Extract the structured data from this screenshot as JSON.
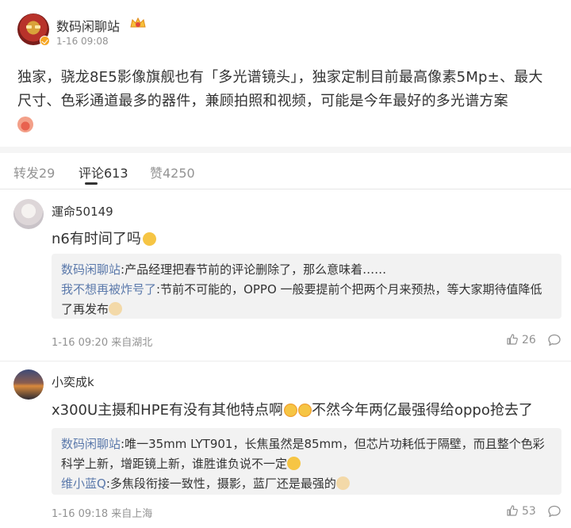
{
  "post": {
    "author": "数码闲聊站",
    "time": "1-16 09:08",
    "body": "独家，骁龙8E5影像旗舰也有「多光谱镜头」，独家定制目前最高像素5Mp±、最大尺寸、色彩通道最多的器件，兼顾拍照和视频，可能是今年最好的多光谱方案"
  },
  "tabs": [
    {
      "label": "转发29"
    },
    {
      "label": "评论613"
    },
    {
      "label": "赞4250"
    }
  ],
  "comments": [
    {
      "name": "運命50149",
      "text": "n6有时间了吗",
      "replies": [
        {
          "user": "数码闲聊站",
          "text": ":产品经理把春节前的评论删除了，那么意味着……"
        },
        {
          "user": "我不想再被炸号了",
          "text": ":节前不可能的，OPPO 一般要提前个把两个月来预热，等大家期待值降低了再发布"
        }
      ],
      "meta": "1-16 09:20 来自湖北",
      "likes": "26"
    },
    {
      "name": "小奕成k",
      "text": "x300U主摄和HPE有没有其他特点啊",
      "text2": "不然今年两亿最强得给oppo抢去了",
      "replies": [
        {
          "user": "数码闲聊站",
          "text": ":唯一35mm LYT901，长焦虽然是85mm，但芯片功耗低于隔壁，而且整个色彩科学上新，增距镜上新，谁胜谁负说不一定"
        },
        {
          "user": "维小蓝Q",
          "text": ":多焦段衔接一致性，摄影，蓝厂还是最强的"
        }
      ],
      "meta": "1-16 09:18 来自上海",
      "likes": "53"
    }
  ],
  "icons": {
    "verified": "verified-badge-icon",
    "crown": "crown-badge-icon",
    "like": "thumbs-up-icon",
    "comment": "comment-bubble-icon"
  },
  "colors": {
    "reply_user": "#5b79ab",
    "meta": "#939393",
    "reply_bg": "#f2f2f2"
  }
}
